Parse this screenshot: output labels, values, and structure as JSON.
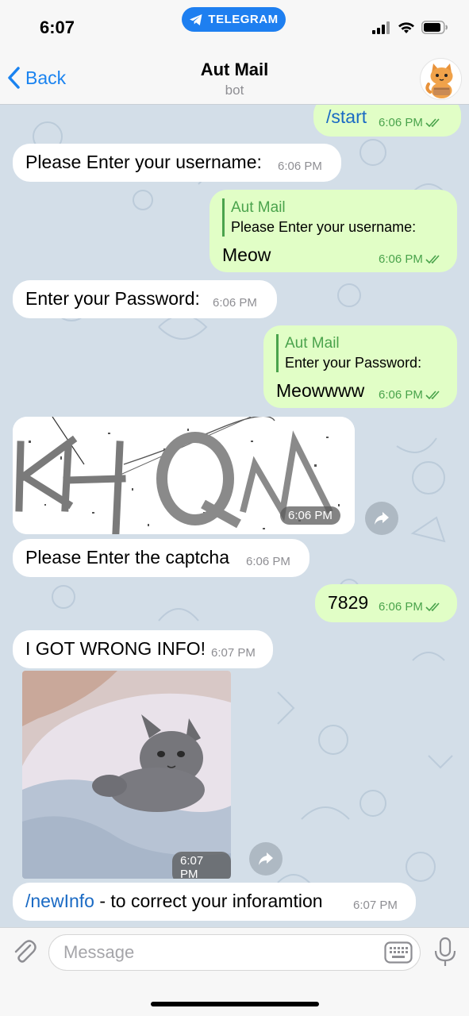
{
  "status_bar": {
    "time": "6:07",
    "app_pill": "TELEGRAM"
  },
  "nav": {
    "back_label": "Back",
    "title": "Aut Mail",
    "subtitle": "bot"
  },
  "messages": {
    "m1": {
      "text": "/start",
      "time": "6:06 PM"
    },
    "m2": {
      "text": "Please Enter your username:",
      "time": "6:06 PM"
    },
    "m3": {
      "reply_name": "Aut Mail",
      "reply_text": "Please Enter your username:",
      "text": "Meow",
      "time": "6:06 PM"
    },
    "m4": {
      "text": "Enter your Password:",
      "time": "6:06 PM"
    },
    "m5": {
      "reply_name": "Aut Mail",
      "reply_text": "Enter your Password:",
      "text": "Meowwww",
      "time": "6:06 PM"
    },
    "m6": {
      "captcha_text": "KHQM",
      "time": "6:06 PM"
    },
    "m7": {
      "text": "Please Enter the captcha",
      "time": "6:06 PM"
    },
    "m8": {
      "text": "7829",
      "time": "6:06 PM"
    },
    "m9": {
      "text": "I GOT WRONG INFO!",
      "time": "6:07 PM"
    },
    "m10": {
      "time": "6:07 PM"
    },
    "m11": {
      "command": "/newInfo",
      "text": " - to correct your inforamtion",
      "time": "6:07 PM"
    }
  },
  "input": {
    "placeholder": "Message"
  },
  "colors": {
    "accent": "#1a83f0",
    "outgoing_bubble": "#e1fec6",
    "incoming_bubble": "#ffffff",
    "check_green": "#4aa34c",
    "wallpaper": "#d3dee8"
  },
  "icons": [
    "telegram-icon",
    "signal-icon",
    "wifi-icon",
    "battery-icon",
    "back-chevron-icon",
    "double-check-icon",
    "share-icon",
    "attach-icon",
    "keyboard-icon",
    "microphone-icon"
  ]
}
